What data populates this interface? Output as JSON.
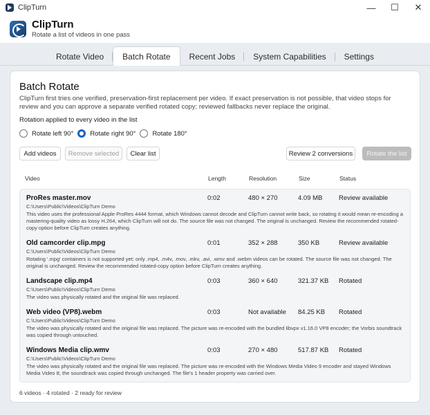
{
  "window": {
    "title": "ClipTurn",
    "minimize": "—",
    "maximize": "☐",
    "close": "✕"
  },
  "app": {
    "name": "ClipTurn",
    "subtitle": "Rotate a list of videos in one pass"
  },
  "tabs": [
    {
      "label": "Rotate Video"
    },
    {
      "label": "Batch Rotate",
      "active": true
    },
    {
      "label": "Recent Jobs"
    },
    {
      "label": "System Capabilities"
    },
    {
      "label": "Settings"
    }
  ],
  "page": {
    "title": "Batch Rotate",
    "intro": "ClipTurn first tries one verified, preservation-first replacement per video. If exact preservation is not possible, that video stops for review and you can approve a separate verified rotated copy; reviewed fallbacks never replace the original.",
    "rotation_label": "Rotation applied to every video in the list",
    "rotation_options": [
      {
        "label": "Rotate left 90°",
        "selected": false
      },
      {
        "label": "Rotate right 90°",
        "selected": true
      },
      {
        "label": "Rotate 180°",
        "selected": false
      }
    ]
  },
  "toolbar": {
    "add": "Add videos",
    "remove": "Remove selected",
    "clear": "Clear list",
    "review": "Review 2 conversions",
    "rotate": "Rotate the list"
  },
  "columns": {
    "video": "Video",
    "length": "Length",
    "resolution": "Resolution",
    "size": "Size",
    "status": "Status"
  },
  "rows": [
    {
      "name": "ProRes master.mov",
      "path": "C:\\Users\\Public\\Videos\\ClipTurn Demo",
      "length": "0:02",
      "resolution": "480 × 270",
      "size": "4.09 MB",
      "status": "Review available",
      "message": "This video uses the professional Apple ProRes 4444 format, which Windows cannot decode and ClipTurn cannot write back, so rotating it would mean re-encoding a mastering-quality video as lossy H.264, which ClipTurn will not do. The source file was not changed. The original is unchanged. Review the recommended rotated-copy option before ClipTurn creates anything."
    },
    {
      "name": "Old camcorder clip.mpg",
      "path": "C:\\Users\\Public\\Videos\\ClipTurn Demo",
      "length": "0:01",
      "resolution": "352 × 288",
      "size": "350 KB",
      "status": "Review available",
      "message": "Rotating '.mpg' containers is not supported yet; only .mp4, .m4v, .mov, .mkv, .avi, .wmv and .webm videos can be rotated. The source file was not changed. The original is unchanged. Review the recommended rotated-copy option before ClipTurn creates anything."
    },
    {
      "name": "Landscape clip.mp4",
      "path": "C:\\Users\\Public\\Videos\\ClipTurn Demo",
      "length": "0:03",
      "resolution": "360 × 640",
      "size": "321.37 KB",
      "status": "Rotated",
      "message": "The video was physically rotated and the original file was replaced."
    },
    {
      "name": "Web video (VP8).webm",
      "path": "C:\\Users\\Public\\Videos\\ClipTurn Demo",
      "length": "0:03",
      "resolution": "Not available",
      "size": "84.25 KB",
      "status": "Rotated",
      "message": "The video was physically rotated and the original file was replaced. The picture was re-encoded with the bundled libvpx v1.16.0 VP8 encoder; the Vorbis soundtrack was copied through untouched."
    },
    {
      "name": "Windows Media clip.wmv",
      "path": "C:\\Users\\Public\\Videos\\ClipTurn Demo",
      "length": "0:03",
      "resolution": "270 × 480",
      "size": "517.87 KB",
      "status": "Rotated",
      "message": "The video was physically rotated and the original file was replaced. The picture was re-encoded with the Windows Media Video 9 encoder and stayed Windows Media Video 8; the soundtrack was copied through unchanged. The file's 1 header property was carried over."
    }
  ],
  "footer": "6 videos · 4 rotated · 2 ready for review"
}
